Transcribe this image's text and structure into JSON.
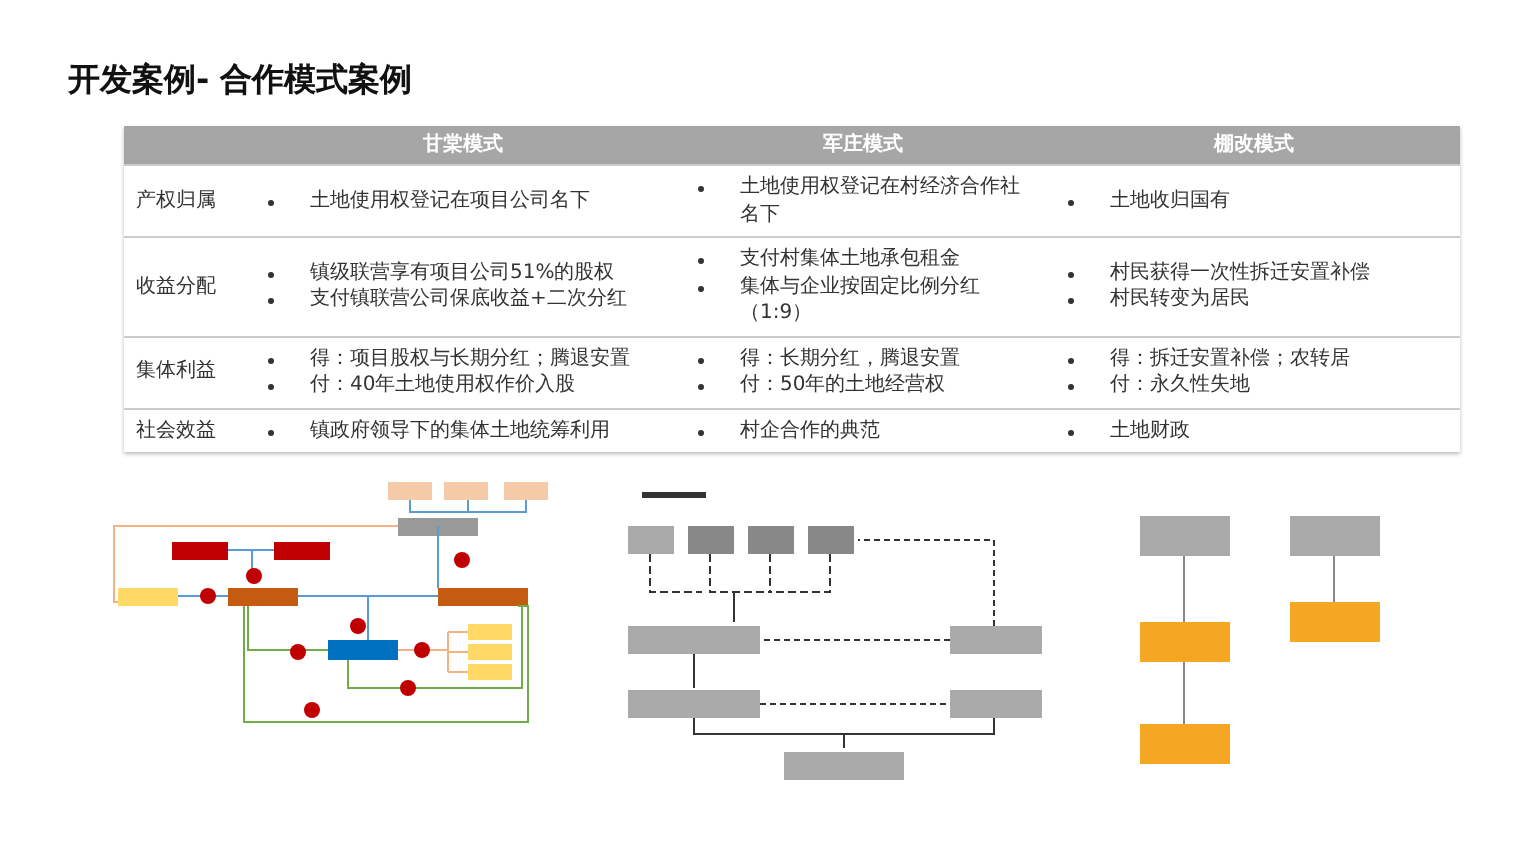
{
  "title": "开发案例- 合作模式案例",
  "table": {
    "columns": [
      "甘棠模式",
      "军庄模式",
      "棚改模式"
    ],
    "rows": [
      {
        "label": "产权归属",
        "cells": [
          [
            "土地使用权登记在项目公司名下"
          ],
          [
            "土地使用权登记在村经济合作社名下"
          ],
          [
            "土地收归国有"
          ]
        ]
      },
      {
        "label": "收益分配",
        "cells": [
          [
            "镇级联营享有项目公司51%的股权",
            "支付镇联营公司保底收益+二次分红"
          ],
          [
            "支付村集体土地承包租金",
            "集体与企业按固定比例分红（1:9）"
          ],
          [
            "村民获得一次性拆迁安置补偿",
            "村民转变为居民"
          ]
        ]
      },
      {
        "label": "集体利益",
        "cells": [
          [
            "得：项目股权与长期分红；腾退安置",
            "付：40年土地使用权作价入股"
          ],
          [
            "得：长期分红，腾退安置",
            "付：50年的土地经营权"
          ],
          [
            "得：拆迁安置补偿；农转居",
            "付：永久性失地"
          ]
        ]
      },
      {
        "label": "社会效益",
        "cells": [
          [
            "镇政府领导下的集体土地统筹利用"
          ],
          [
            "村企合作的典范"
          ],
          [
            "土地财政"
          ]
        ]
      }
    ]
  }
}
